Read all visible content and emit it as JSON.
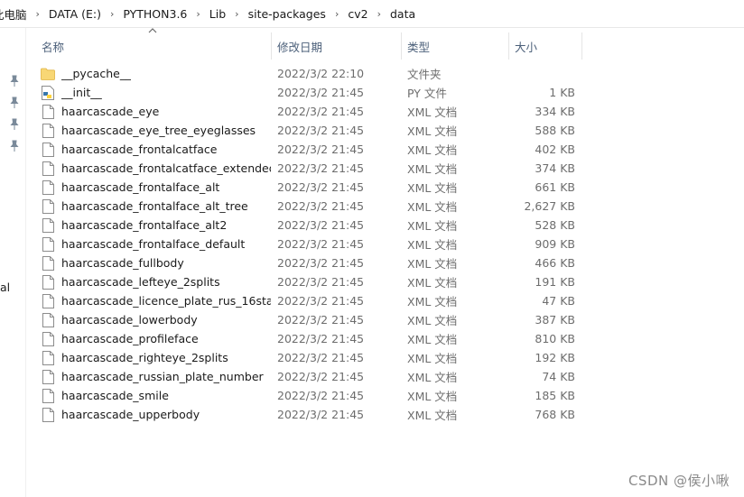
{
  "breadcrumb": [
    "此电脑",
    "DATA (E:)",
    "PYTHON3.6",
    "Lib",
    "site-packages",
    "cv2",
    "data"
  ],
  "nav": {
    "partial_label": "al"
  },
  "columns": {
    "name": "名称",
    "date": "修改日期",
    "type": "类型",
    "size": "大小"
  },
  "files": [
    {
      "icon": "folder-icon",
      "name": "__pycache__",
      "date": "2022/3/2 22:10",
      "type": "文件夹",
      "size": ""
    },
    {
      "icon": "python-file-icon",
      "name": "__init__",
      "date": "2022/3/2 21:45",
      "type": "PY 文件",
      "size": "1 KB"
    },
    {
      "icon": "document-icon",
      "name": "haarcascade_eye",
      "date": "2022/3/2 21:45",
      "type": "XML 文档",
      "size": "334 KB"
    },
    {
      "icon": "document-icon",
      "name": "haarcascade_eye_tree_eyeglasses",
      "date": "2022/3/2 21:45",
      "type": "XML 文档",
      "size": "588 KB"
    },
    {
      "icon": "document-icon",
      "name": "haarcascade_frontalcatface",
      "date": "2022/3/2 21:45",
      "type": "XML 文档",
      "size": "402 KB"
    },
    {
      "icon": "document-icon",
      "name": "haarcascade_frontalcatface_extended",
      "date": "2022/3/2 21:45",
      "type": "XML 文档",
      "size": "374 KB"
    },
    {
      "icon": "document-icon",
      "name": "haarcascade_frontalface_alt",
      "date": "2022/3/2 21:45",
      "type": "XML 文档",
      "size": "661 KB"
    },
    {
      "icon": "document-icon",
      "name": "haarcascade_frontalface_alt_tree",
      "date": "2022/3/2 21:45",
      "type": "XML 文档",
      "size": "2,627 KB"
    },
    {
      "icon": "document-icon",
      "name": "haarcascade_frontalface_alt2",
      "date": "2022/3/2 21:45",
      "type": "XML 文档",
      "size": "528 KB"
    },
    {
      "icon": "document-icon",
      "name": "haarcascade_frontalface_default",
      "date": "2022/3/2 21:45",
      "type": "XML 文档",
      "size": "909 KB"
    },
    {
      "icon": "document-icon",
      "name": "haarcascade_fullbody",
      "date": "2022/3/2 21:45",
      "type": "XML 文档",
      "size": "466 KB"
    },
    {
      "icon": "document-icon",
      "name": "haarcascade_lefteye_2splits",
      "date": "2022/3/2 21:45",
      "type": "XML 文档",
      "size": "191 KB"
    },
    {
      "icon": "document-icon",
      "name": "haarcascade_licence_plate_rus_16sta...",
      "date": "2022/3/2 21:45",
      "type": "XML 文档",
      "size": "47 KB"
    },
    {
      "icon": "document-icon",
      "name": "haarcascade_lowerbody",
      "date": "2022/3/2 21:45",
      "type": "XML 文档",
      "size": "387 KB"
    },
    {
      "icon": "document-icon",
      "name": "haarcascade_profileface",
      "date": "2022/3/2 21:45",
      "type": "XML 文档",
      "size": "810 KB"
    },
    {
      "icon": "document-icon",
      "name": "haarcascade_righteye_2splits",
      "date": "2022/3/2 21:45",
      "type": "XML 文档",
      "size": "192 KB"
    },
    {
      "icon": "document-icon",
      "name": "haarcascade_russian_plate_number",
      "date": "2022/3/2 21:45",
      "type": "XML 文档",
      "size": "74 KB"
    },
    {
      "icon": "document-icon",
      "name": "haarcascade_smile",
      "date": "2022/3/2 21:45",
      "type": "XML 文档",
      "size": "185 KB"
    },
    {
      "icon": "document-icon",
      "name": "haarcascade_upperbody",
      "date": "2022/3/2 21:45",
      "type": "XML 文档",
      "size": "768 KB"
    }
  ],
  "watermark": "CSDN @侯小啾",
  "colors": {
    "header_text": "#4c607a",
    "folder": "#f8d775",
    "detail_text": "#6d6d6d"
  }
}
